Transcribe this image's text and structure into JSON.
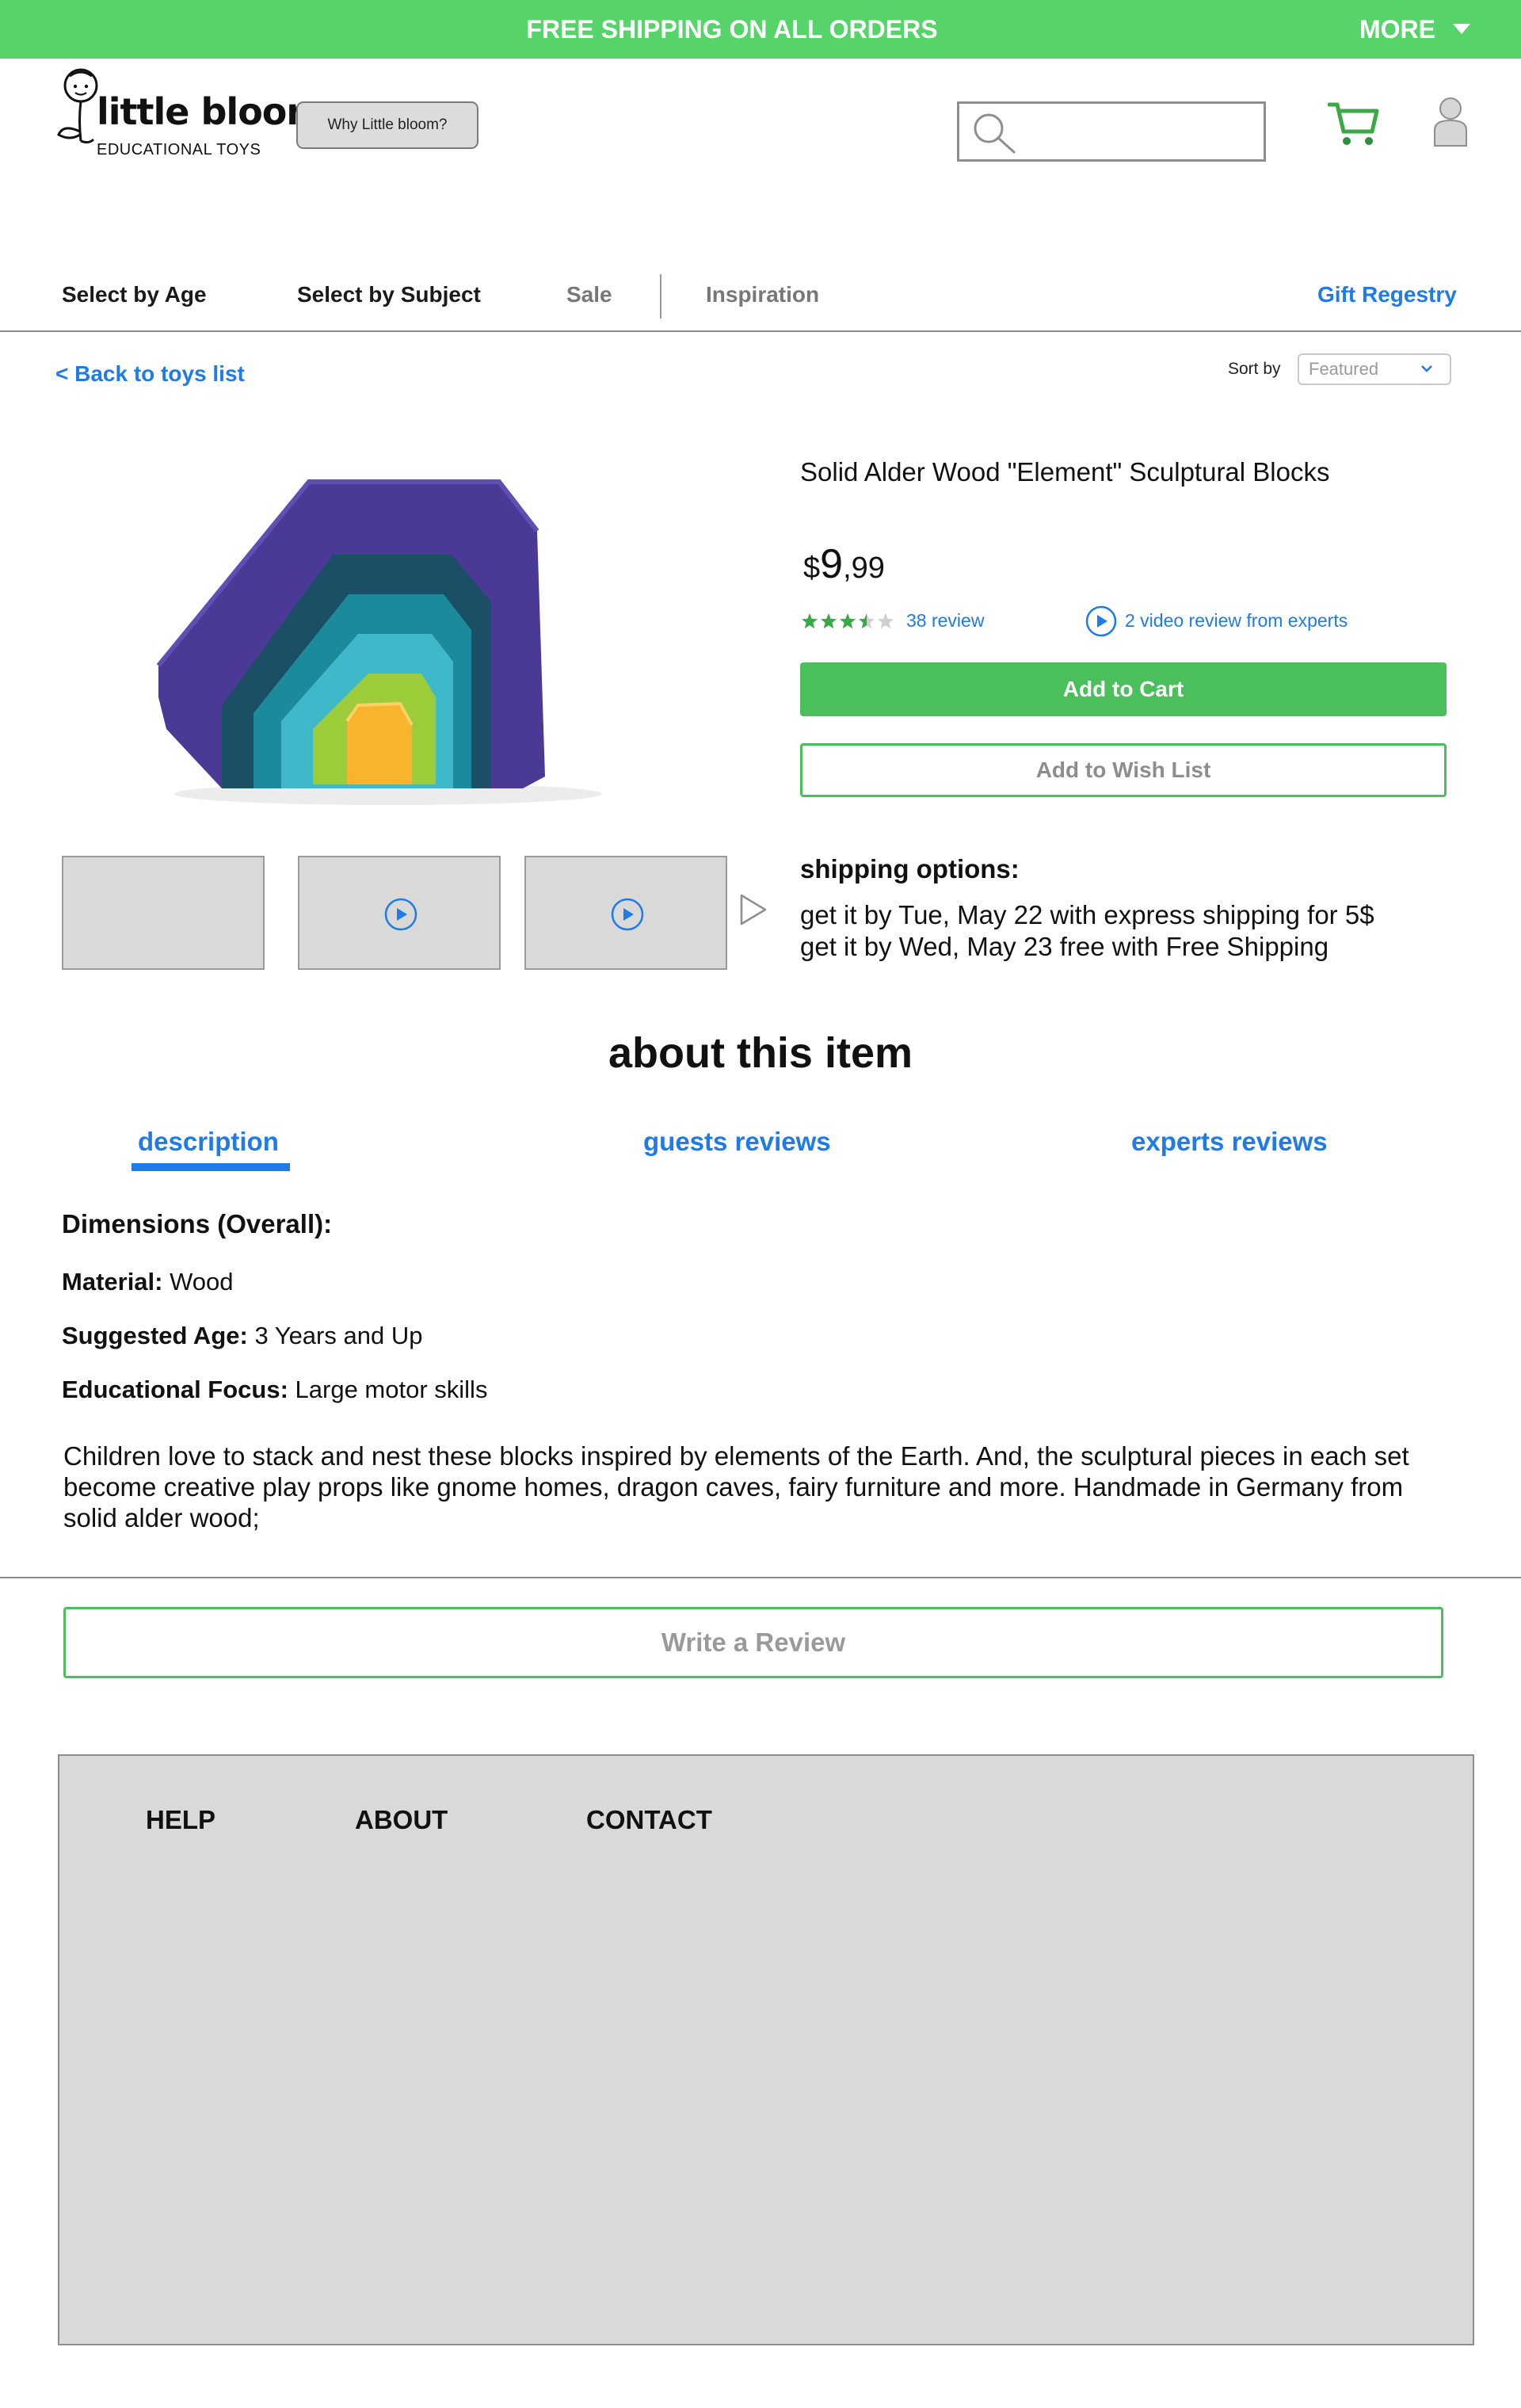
{
  "banner": {
    "text": "FREE SHIPPING ON ALL ORDERS",
    "more_label": "MORE",
    "bg_color": "#56d46a"
  },
  "header": {
    "logo_name": "little bloom",
    "logo_subtitle": "EDUCATIONAL TOYS",
    "why_button_label": "Why Little bloom?",
    "search_placeholder": "",
    "icons": [
      "search-icon",
      "cart-icon",
      "user-icon"
    ]
  },
  "nav": {
    "items": [
      {
        "label": "Select by Age"
      },
      {
        "label": "Select by Subject"
      },
      {
        "label": "Sale"
      },
      {
        "label": "Inspiration"
      }
    ],
    "gift_label": "Gift Regestry"
  },
  "toolbar": {
    "back_label": "< Back to toys list",
    "sort_label": "Sort by",
    "sort_value": "Featured"
  },
  "product": {
    "title": "Solid Alder Wood \"Element\" Sculptural Blocks",
    "price": {
      "currency": "$",
      "main": "9",
      "cents": ",99"
    },
    "rating_stars": 3.5,
    "rating_max": 5,
    "review_label": "38 review",
    "video_review_label": "2 video review from experts",
    "add_to_cart_label": "Add to Cart",
    "add_to_wishlist_label": "Add to Wish List",
    "thumbnails": [
      {
        "type": "image"
      },
      {
        "type": "video"
      },
      {
        "type": "video"
      }
    ],
    "accent_color": "#4bbf5b",
    "link_color": "#1f7be8"
  },
  "shipping": {
    "title": "shipping options:",
    "options": [
      "get it by Tue, May 22 with express shipping for 5$",
      "get it by Wed, May 23 free with Free Shipping"
    ]
  },
  "about": {
    "title": "about this item",
    "tabs": [
      {
        "label": "description",
        "active": true
      },
      {
        "label": "guests reviews",
        "active": false
      },
      {
        "label": "experts reviews",
        "active": false
      }
    ],
    "specs": {
      "dimensions_label": "Dimensions (Overall):",
      "material_label": "Material:",
      "material_value": " Wood",
      "age_label": "Suggested Age:",
      "age_value": " 3 Years and Up",
      "focus_label": "Educational Focus:",
      "focus_value": " Large motor skills"
    },
    "description": "Children love to stack and nest these blocks inspired by elements of the Earth. And, the sculptural pieces in each set become creative play props like gnome homes, dragon caves, fairy furniture and more. Handmade in Germany from solid alder wood;",
    "write_review_label": "Write a Review"
  },
  "footer": {
    "links": [
      {
        "label": "HELP"
      },
      {
        "label": "ABOUT"
      },
      {
        "label": "CONTACT"
      }
    ]
  }
}
